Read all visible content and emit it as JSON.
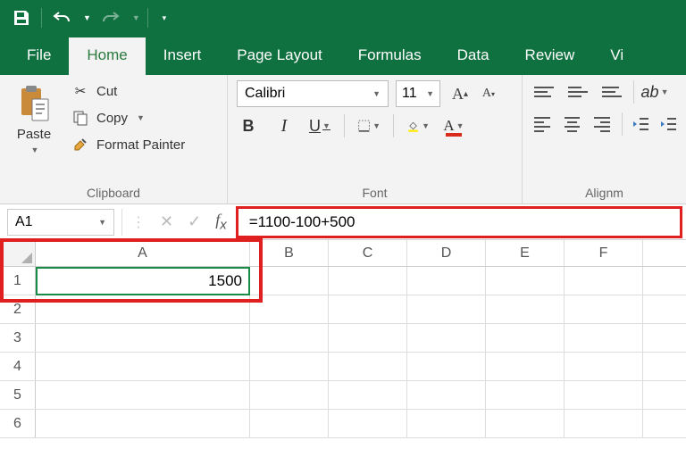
{
  "titlebar": {
    "title": ""
  },
  "tabs": {
    "file": "File",
    "home": "Home",
    "insert": "Insert",
    "page_layout": "Page Layout",
    "formulas": "Formulas",
    "data": "Data",
    "review": "Review",
    "view": "Vi"
  },
  "ribbon": {
    "clipboard": {
      "label": "Clipboard",
      "paste": "Paste",
      "cut": "Cut",
      "copy": "Copy",
      "format_painter": "Format Painter"
    },
    "font": {
      "label": "Font",
      "name": "Calibri",
      "size": "11"
    },
    "align": {
      "label": "Alignm"
    }
  },
  "formula_bar": {
    "name_box": "A1",
    "formula": "=1100-100+500"
  },
  "columns": [
    "A",
    "B",
    "C",
    "D",
    "E",
    "F"
  ],
  "rows": [
    {
      "num": "1",
      "cells": [
        "1500",
        "",
        "",
        "",
        "",
        ""
      ]
    },
    {
      "num": "2",
      "cells": [
        "",
        "",
        "",
        "",
        "",
        ""
      ]
    },
    {
      "num": "3",
      "cells": [
        "",
        "",
        "",
        "",
        "",
        ""
      ]
    },
    {
      "num": "4",
      "cells": [
        "",
        "",
        "",
        "",
        "",
        ""
      ]
    },
    {
      "num": "5",
      "cells": [
        "",
        "",
        "",
        "",
        "",
        ""
      ]
    },
    {
      "num": "6",
      "cells": [
        "",
        "",
        "",
        "",
        "",
        ""
      ]
    }
  ]
}
